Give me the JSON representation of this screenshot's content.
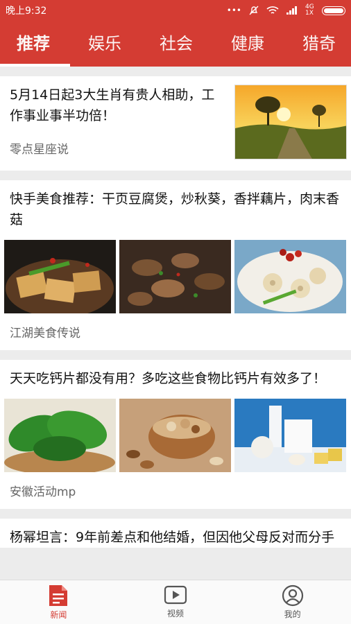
{
  "status_bar": {
    "time": "晚上9:32",
    "network": "4G 1X"
  },
  "tabs": [
    "推荐",
    "娱乐",
    "社会",
    "健康",
    "猎奇"
  ],
  "feed": [
    {
      "title": "5月14日起3大生肖有贵人相助，工作事业事半功倍！",
      "source": "零点星座说"
    },
    {
      "title": "快手美食推荐：干页豆腐煲，炒秋葵，香拌藕片，肉末香菇",
      "source": "江湖美食传说"
    },
    {
      "title": "天天吃钙片都没有用？多吃这些食物比钙片有效多了！",
      "source": "安徽活动mp"
    },
    {
      "title": "杨幂坦言：9年前差点和他结婚，但因他父母反对而分手"
    }
  ],
  "bottom_nav": [
    {
      "label": "新闻",
      "icon": "news-icon"
    },
    {
      "label": "视频",
      "icon": "video-icon"
    },
    {
      "label": "我的",
      "icon": "profile-icon"
    }
  ],
  "colors": {
    "brand": "#d43c33",
    "nav_inactive": "#555555"
  }
}
